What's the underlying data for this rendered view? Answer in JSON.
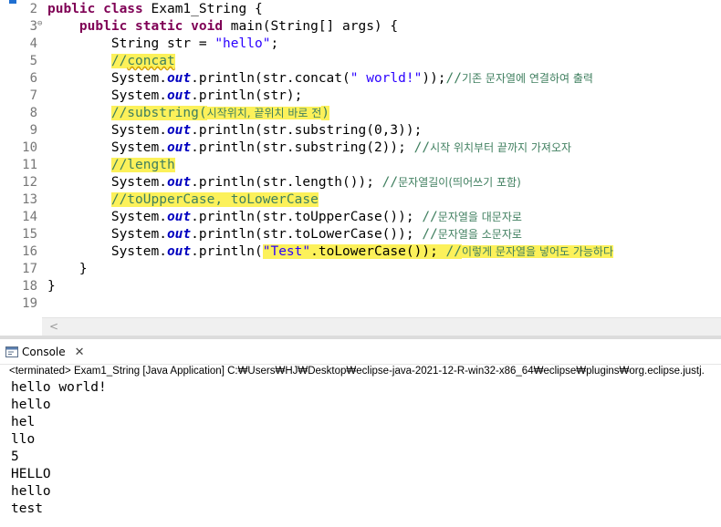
{
  "editor": {
    "lines": [
      {
        "num": "2",
        "fold": "",
        "parts": [
          {
            "t": "public class ",
            "c": "kw"
          },
          {
            "t": "Exam1_String {",
            "c": ""
          }
        ]
      },
      {
        "num": "3",
        "fold": "⊖",
        "parts": [
          {
            "t": "    "
          },
          {
            "t": "public static void ",
            "c": "kw"
          },
          {
            "t": "main(String[] args) {",
            "c": ""
          }
        ]
      },
      {
        "num": "4",
        "fold": "",
        "parts": [
          {
            "t": "        String str = "
          },
          {
            "t": "\"hello\"",
            "c": "str"
          },
          {
            "t": ";"
          }
        ]
      },
      {
        "num": "5",
        "fold": "",
        "parts": [
          {
            "t": "        "
          },
          {
            "t": "//",
            "c": "cm hl"
          },
          {
            "t": "concat",
            "c": "cm hl squig"
          }
        ]
      },
      {
        "num": "6",
        "fold": "",
        "parts": [
          {
            "t": "        System."
          },
          {
            "t": "out",
            "c": "fld"
          },
          {
            "t": ".println(str.concat("
          },
          {
            "t": "\" world!\"",
            "c": "str"
          },
          {
            "t": "));"
          },
          {
            "t": "//",
            "c": "cm"
          },
          {
            "t": "기존 문자열에 연결하여 출력",
            "c": "kcm"
          }
        ]
      },
      {
        "num": "7",
        "fold": "",
        "parts": [
          {
            "t": "        System."
          },
          {
            "t": "out",
            "c": "fld"
          },
          {
            "t": ".println(str);"
          }
        ]
      },
      {
        "num": "8",
        "fold": "",
        "parts": [
          {
            "t": "        "
          },
          {
            "t": "//substring(",
            "c": "cm hl"
          },
          {
            "t": "시작위치, 끝위치 바로 전",
            "c": "kcm hl"
          },
          {
            "t": ")",
            "c": "cm hl"
          }
        ]
      },
      {
        "num": "9",
        "fold": "",
        "parts": [
          {
            "t": "        System."
          },
          {
            "t": "out",
            "c": "fld"
          },
          {
            "t": ".println(str.substring(0,3));"
          }
        ]
      },
      {
        "num": "10",
        "fold": "",
        "parts": [
          {
            "t": "        System."
          },
          {
            "t": "out",
            "c": "fld"
          },
          {
            "t": ".println(str.substring(2)); "
          },
          {
            "t": "//",
            "c": "cm"
          },
          {
            "t": "시작 위치부터 끝까지 가져오자",
            "c": "kcm"
          }
        ]
      },
      {
        "num": "11",
        "fold": "",
        "parts": [
          {
            "t": "        "
          },
          {
            "t": "//length",
            "c": "cm hl"
          }
        ]
      },
      {
        "num": "12",
        "fold": "",
        "parts": [
          {
            "t": "        System."
          },
          {
            "t": "out",
            "c": "fld"
          },
          {
            "t": ".println(str.length()); "
          },
          {
            "t": "//",
            "c": "cm"
          },
          {
            "t": "문자열길이(띄어쓰기 포함)",
            "c": "kcm"
          }
        ]
      },
      {
        "num": "13",
        "fold": "",
        "parts": [
          {
            "t": "        "
          },
          {
            "t": "//toUpperCase, toLowerCase",
            "c": "cm hl"
          }
        ]
      },
      {
        "num": "14",
        "fold": "",
        "parts": [
          {
            "t": "        System."
          },
          {
            "t": "out",
            "c": "fld"
          },
          {
            "t": ".println(str.toUpperCase()); "
          },
          {
            "t": "//",
            "c": "cm"
          },
          {
            "t": "문자열을 대문자로",
            "c": "kcm"
          }
        ]
      },
      {
        "num": "15",
        "fold": "",
        "parts": [
          {
            "t": "        System."
          },
          {
            "t": "out",
            "c": "fld"
          },
          {
            "t": ".println(str.toLowerCase()); "
          },
          {
            "t": "//",
            "c": "cm"
          },
          {
            "t": "문자열을 소문자로",
            "c": "kcm"
          }
        ]
      },
      {
        "num": "16",
        "fold": "",
        "parts": [
          {
            "t": "        System."
          },
          {
            "t": "out",
            "c": "fld"
          },
          {
            "t": ".println("
          },
          {
            "t": "\"Test\"",
            "c": "str hl"
          },
          {
            "t": ".toLowerCase()); ",
            "c": "hl"
          },
          {
            "t": "//",
            "c": "cm hl"
          },
          {
            "t": "이렇게 문자열을 넣어도 가능하다",
            "c": "kcm hl"
          }
        ]
      },
      {
        "num": "17",
        "fold": "",
        "parts": [
          {
            "t": "    }"
          }
        ]
      },
      {
        "num": "18",
        "fold": "",
        "parts": [
          {
            "t": "}"
          }
        ]
      },
      {
        "num": "19",
        "fold": "",
        "parts": []
      }
    ]
  },
  "scroll": {
    "left_arrow": "<"
  },
  "console": {
    "tab_label": "Console",
    "close_symbol": "✕",
    "status": "<terminated> Exam1_String [Java Application] C:₩Users₩HJ₩Desktop₩eclipse-java-2021-12-R-win32-x86_64₩eclipse₩plugins₩org.eclipse.justj.",
    "output": [
      "hello world!",
      "hello",
      "hel",
      "llo",
      "5",
      "HELLO",
      "hello",
      "test"
    ]
  },
  "colors": {
    "highlight": "#fcf15a",
    "keyword": "#7f0055",
    "string": "#2a00ff",
    "comment": "#3f7f5f",
    "field": "#0000c0"
  },
  "icons": {
    "console_tab": "console-icon",
    "close": "close-icon",
    "fold": "fold-collapse-icon"
  }
}
